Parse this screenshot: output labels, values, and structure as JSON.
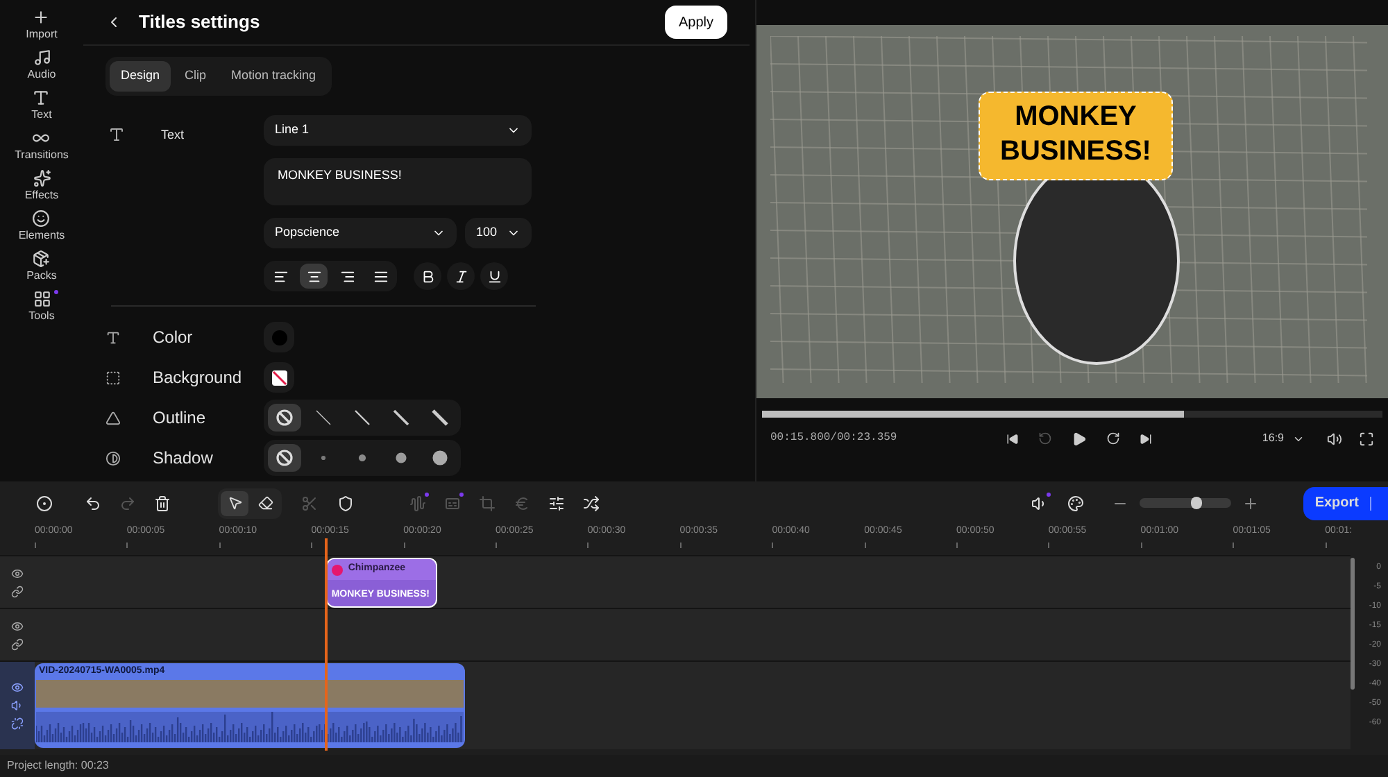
{
  "sidebar": {
    "items": [
      {
        "label": "Import",
        "dot": false
      },
      {
        "label": "Audio",
        "dot": false
      },
      {
        "label": "Text",
        "dot": false
      },
      {
        "label": "Transitions",
        "dot": false
      },
      {
        "label": "Effects",
        "dot": false
      },
      {
        "label": "Elements",
        "dot": false
      },
      {
        "label": "Packs",
        "dot": false
      },
      {
        "label": "Tools",
        "dot": true
      }
    ]
  },
  "panel": {
    "title": "Titles settings",
    "apply": "Apply",
    "tabs": [
      {
        "label": "Design",
        "selected": true
      },
      {
        "label": "Clip",
        "selected": false
      },
      {
        "label": "Motion tracking",
        "selected": false
      }
    ],
    "text": {
      "label": "Text",
      "line": "Line 1",
      "value": "MONKEY BUSINESS!",
      "font": "Popscience",
      "size": "100",
      "align": [
        {
          "selected": false
        },
        {
          "selected": true
        },
        {
          "selected": false
        },
        {
          "selected": false
        }
      ],
      "styles": [
        {
          "on": false
        },
        {
          "on": false
        },
        {
          "on": false
        }
      ]
    },
    "color": {
      "label": "Color",
      "color": "#000000"
    },
    "background": {
      "label": "Background"
    },
    "outline": {
      "label": "Outline",
      "options": [
        {
          "selected": true
        },
        {
          "selected": false
        },
        {
          "selected": false
        },
        {
          "selected": false
        },
        {
          "selected": false
        }
      ]
    },
    "shadow": {
      "label": "Shadow",
      "options": [
        {
          "selected": true
        },
        {
          "selected": false
        },
        {
          "selected": false
        },
        {
          "selected": false
        },
        {
          "selected": false
        }
      ]
    }
  },
  "preview": {
    "overlay": "MONKEY BUSINESS!",
    "progress": {
      "level": 0.68
    },
    "time": "00:15.800/00:23.359",
    "aspect": "16:9"
  },
  "toolbar": {
    "buttons": [
      {
        "disabled": false
      },
      {
        "disabled": false
      },
      {
        "disabled": true
      },
      {
        "disabled": false
      }
    ],
    "modes": [
      {
        "selected": true
      },
      {
        "selected": false
      }
    ],
    "edit": [
      {
        "disabled": true
      },
      {
        "disabled": false
      }
    ],
    "more": [
      {
        "disabled": true,
        "dot": true
      },
      {
        "disabled": true,
        "dot": true
      },
      {
        "disabled": true,
        "dot": false
      },
      {
        "disabled": true,
        "dot": false
      },
      {
        "disabled": false,
        "dot": false
      },
      {
        "disabled": false,
        "dot": false
      }
    ],
    "right": [
      {
        "dot": true
      },
      {
        "dot": false
      }
    ],
    "zoom": {
      "level": 0.62
    },
    "export": "Export"
  },
  "ruler": [
    "00:00:00",
    "00:00:05",
    "00:00:10",
    "00:00:15",
    "00:00:20",
    "00:00:25",
    "00:00:30",
    "00:00:35",
    "00:00:40",
    "00:00:45",
    "00:00:50",
    "00:00:55",
    "00:01:00",
    "00:01:05",
    "00:01:"
  ],
  "tracks": [
    {
      "kind": "title",
      "clip": {
        "title": "Chimpanzee",
        "text": "MONKEY BUSINESS!"
      }
    },
    {
      "kind": "empty"
    },
    {
      "kind": "video",
      "clip": {
        "name": "VID-20240715-WA0005.mp4"
      }
    }
  ],
  "meter": [
    "0",
    "-5",
    "-10",
    "-15",
    "-20",
    "-30",
    "-40",
    "-50",
    "-60"
  ],
  "status_bar": "Project length: 00:23"
}
